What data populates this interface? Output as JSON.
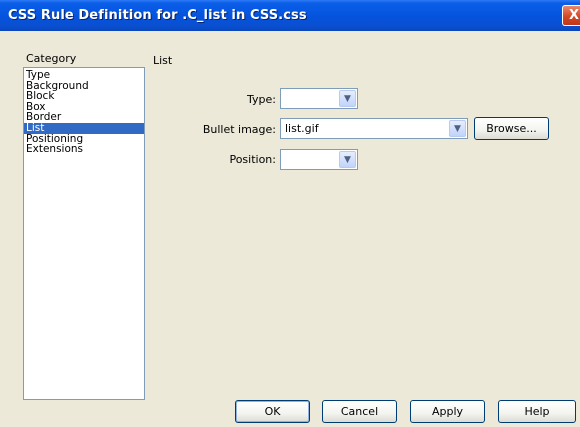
{
  "window": {
    "title": "CSS Rule Definition for .C_list in CSS.css",
    "close_label": "X"
  },
  "category": {
    "header": "Category",
    "items": [
      "Type",
      "Background",
      "Block",
      "Box",
      "Border",
      "List",
      "Positioning",
      "Extensions"
    ],
    "selected": "List"
  },
  "panel": {
    "title": "List",
    "type": {
      "label": "Type:",
      "value": ""
    },
    "bullet_image": {
      "label": "Bullet image:",
      "value": "list.gif"
    },
    "browse_label": "Browse...",
    "position": {
      "label": "Position:",
      "value": ""
    }
  },
  "buttons": {
    "ok": "OK",
    "cancel": "Cancel",
    "apply": "Apply",
    "help": "Help"
  },
  "icons": {
    "dropdown": "chevron-down-icon",
    "close": "close-icon"
  }
}
